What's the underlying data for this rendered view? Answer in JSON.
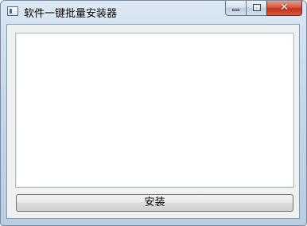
{
  "window": {
    "title": "软件一键批量安装器",
    "close_glyph": "✕"
  },
  "main": {
    "log_text": "",
    "install_button_label": "安装"
  },
  "icons": {
    "app": "application-window-icon",
    "minimize": "minimize-icon",
    "maximize": "maximize-icon",
    "close": "close-icon"
  },
  "colors": {
    "titlebar_top": "#dbe7f3",
    "titlebar_bottom": "#b9cde2",
    "close_red": "#c1341d",
    "client_bg": "#f0f0f0",
    "textarea_border": "#a8c2dc"
  }
}
